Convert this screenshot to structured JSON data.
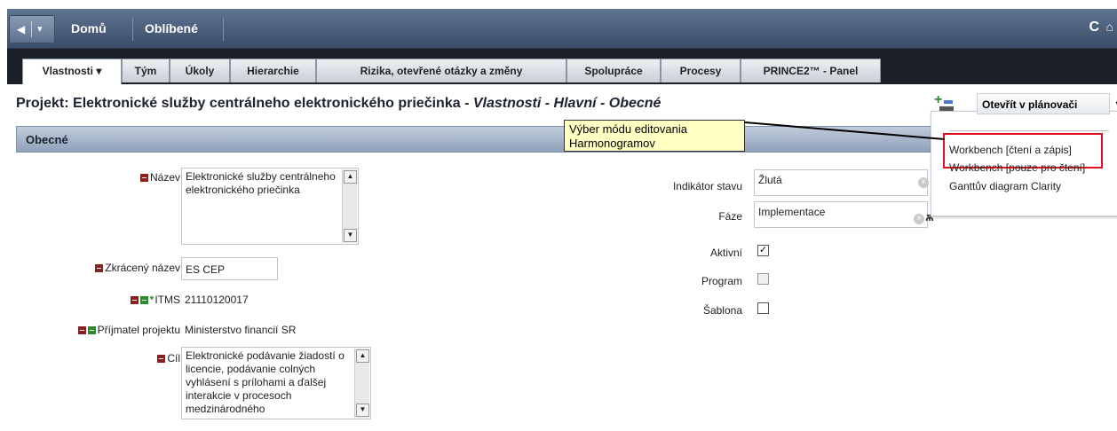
{
  "nav": {
    "back_icon": "◀",
    "dropdown_icon": "▾"
  },
  "topmenu": {
    "home": "Domů",
    "favorites": "Oblíbené"
  },
  "tabs": [
    {
      "label": "Vlastnosti ▾"
    },
    {
      "label": "Tým"
    },
    {
      "label": "Úkoly"
    },
    {
      "label": "Hierarchie"
    },
    {
      "label": "Rizika, otevřené otázky a změny"
    },
    {
      "label": "Spolupráce"
    },
    {
      "label": "Procesy"
    },
    {
      "label": "PRINCE2™ - Panel"
    }
  ],
  "page": {
    "title_prefix": "Projekt: Elektronické služby centrálneho elektronického priečinka - ",
    "title_italic": "Vlastnosti - Hlavní - Obecné"
  },
  "planner": {
    "label": "Otevřít v plánovači",
    "options": [
      "Workbench [čtení a zápis]",
      "Workbench [pouze pro čtení]",
      "Ganttův diagram Clarity"
    ]
  },
  "callout": {
    "line1": "Výber módu editovania",
    "line2": "Harmonogramov"
  },
  "section": {
    "title": "Obecné"
  },
  "fields": {
    "nazev_label": "Název",
    "nazev_value": "Elektronické služby centrálneho elektronického priečinka",
    "zkraceny_label": "Zkrácený název",
    "zkraceny_value": "ES CEP",
    "itms_label": "ITMS",
    "itms_value": "21110120017",
    "prijemce_label": "Příjmatel projektu",
    "prijemce_value": "Ministerstvo financií SR",
    "cil_label": "Cíl",
    "cil_value": "Elektronické podávanie žiadostí o licencie, podávanie colných vyhlásení s prílohami a ďalšej interakcie v procesoch medzinárodného",
    "indikator_label": "Indikátor stavu",
    "indikator_value": "Žlutá",
    "faze_label": "Fáze",
    "faze_value": "Implementace",
    "aktivni_label": "Aktivní",
    "aktivni_checked": true,
    "program_label": "Program",
    "program_checked": false,
    "sablona_label": "Šablona",
    "sablona_checked": false
  },
  "icons": {
    "refresh": "refresh-icon",
    "home": "home-icon",
    "clear": "clear-icon",
    "lookup": "binoculars-icon",
    "planner": "add-to-planner-icon"
  }
}
